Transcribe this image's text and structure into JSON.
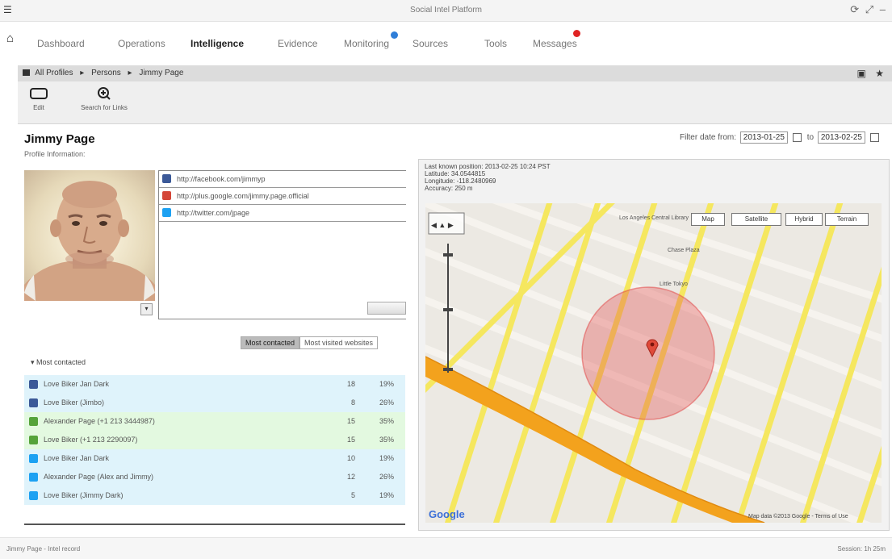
{
  "window": {
    "title": "Social Intel Platform",
    "controls": "⟳ ⤢ –"
  },
  "nav": {
    "items": [
      {
        "label": "Dashboard"
      },
      {
        "label": "Operations"
      },
      {
        "label": "Intelligence"
      },
      {
        "label": "Evidence"
      },
      {
        "label": "Monitoring"
      },
      {
        "label": "Sources"
      },
      {
        "label": "Tools"
      },
      {
        "label": "Messages"
      }
    ]
  },
  "breadcrumb": {
    "items": [
      "All Profiles",
      "Persons",
      "Jimmy Page"
    ],
    "sep": "▸"
  },
  "toolbar": {
    "buttons": [
      {
        "label": "Edit"
      },
      {
        "label": "Search for Links"
      }
    ]
  },
  "profile": {
    "name": "Jimmy Page",
    "subtitle": "Profile Information:",
    "links": [
      {
        "icon": "facebook",
        "color": "#3b5998",
        "text": "http://facebook.com/jimmyp"
      },
      {
        "icon": "gmail",
        "color": "#d44638",
        "text": "http://plus.google.com/jimmy.page.official"
      },
      {
        "icon": "twitter",
        "color": "#1da1f2",
        "text": "http://twitter.com/jpage"
      }
    ]
  },
  "dates": {
    "label_from": "Filter date from:",
    "from": "2013-01-25",
    "label_to": "to",
    "to": "2013-02-25"
  },
  "toggle": {
    "on": "Most contacted",
    "off": "Most visited websites"
  },
  "matches": {
    "label": "▾ Most contacted",
    "rows": [
      {
        "icon": "facebook",
        "bg": "#dff3fb",
        "color": "#3b5998",
        "name": "Love Biker Jan Dark",
        "count": "18",
        "pct": "19%"
      },
      {
        "icon": "facebook",
        "bg": "#dff3fb",
        "color": "#3b5998",
        "name": "Love Biker (Jimbo)",
        "count": "8",
        "pct": "26%"
      },
      {
        "icon": "skype",
        "bg": "#e3f9e0",
        "color": "#55a33a",
        "name": "Alexander Page (+1 213 3444987)",
        "count": "15",
        "pct": "35%"
      },
      {
        "icon": "skype",
        "bg": "#e3f9e0",
        "color": "#55a33a",
        "name": "Love Biker (+1 213 2290097)",
        "count": "15",
        "pct": "35%"
      },
      {
        "icon": "twitter",
        "bg": "#dff3fb",
        "color": "#1da1f2",
        "name": "Love Biker Jan Dark",
        "count": "10",
        "pct": "19%"
      },
      {
        "icon": "twitter",
        "bg": "#dff3fb",
        "color": "#1da1f2",
        "name": "Alexander Page (Alex and Jimmy)",
        "count": "12",
        "pct": "26%"
      },
      {
        "icon": "twitter",
        "bg": "#dff3fb",
        "color": "#1da1f2",
        "name": "Love Biker (Jimmy Dark)",
        "count": "5",
        "pct": "19%"
      }
    ]
  },
  "map": {
    "info": [
      "Last known position: 2013-02-25 10:24 PST",
      "Latitude: 34.0544815",
      "Longitude: -118.2480969",
      "Accuracy: 250 m"
    ],
    "types": [
      "Map",
      "Satellite",
      "Hybrid",
      "Terrain"
    ],
    "pois": [
      "Chase Plaza",
      "Little Tokyo",
      "Los Angeles Central Library"
    ],
    "logo": "Google",
    "copyright": "Map data ©2013 Google - Terms of Use"
  },
  "status": {
    "left": "Jimmy Page - Intel record",
    "right": "Session: 1h 25m"
  }
}
